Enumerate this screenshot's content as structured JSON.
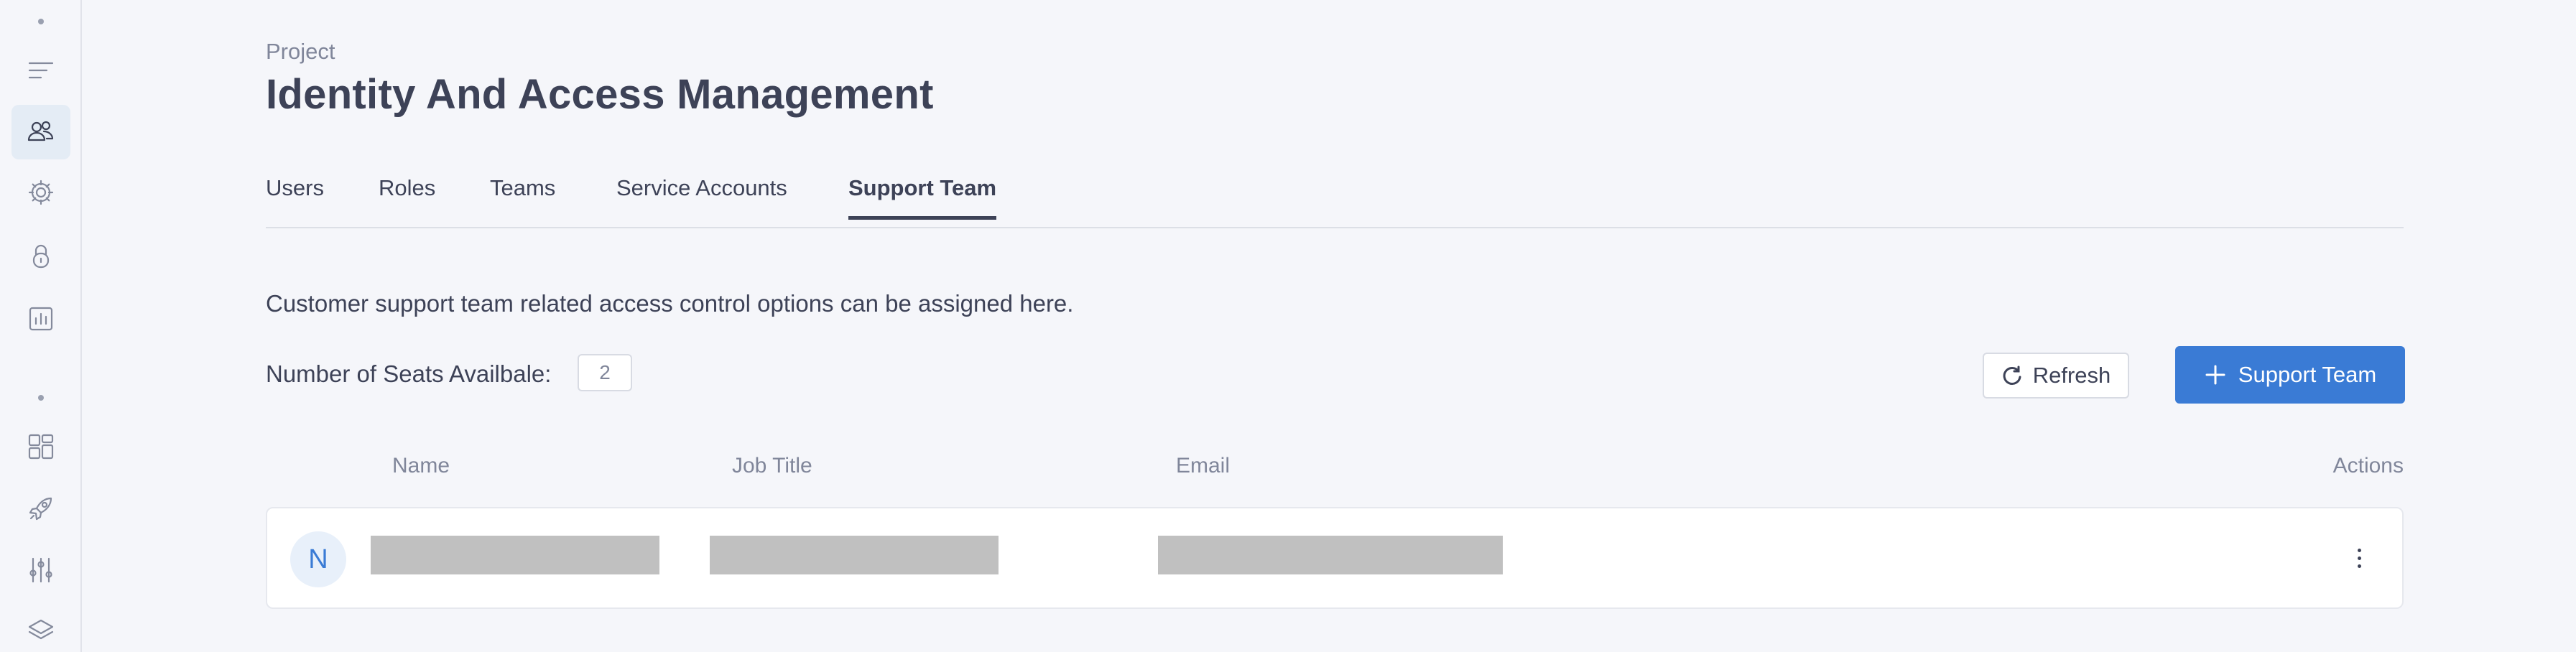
{
  "sidebar": {
    "items": [
      {
        "icon": "menu-lines-icon"
      },
      {
        "icon": "users-icon",
        "active": true
      },
      {
        "icon": "gear-icon"
      },
      {
        "icon": "lock-icon"
      },
      {
        "icon": "bar-chart-icon"
      },
      {
        "icon": "dashboard-grid-icon"
      },
      {
        "icon": "rocket-icon"
      },
      {
        "icon": "sliders-icon"
      },
      {
        "icon": "layers-icon"
      }
    ]
  },
  "header": {
    "eyebrow": "Project",
    "title": "Identity And Access Management"
  },
  "tabs": [
    {
      "label": "Users"
    },
    {
      "label": "Roles"
    },
    {
      "label": "Teams"
    },
    {
      "label": "Service Accounts"
    },
    {
      "label": "Support Team",
      "active": true
    }
  ],
  "content": {
    "description": "Customer support team related access control options can be assigned here.",
    "seats_label": "Number of Seats Availbale:",
    "seats_value": "2",
    "refresh_label": "Refresh",
    "add_label": "Support Team"
  },
  "table": {
    "columns": [
      "Name",
      "Job Title",
      "Email",
      "Actions"
    ],
    "rows": [
      {
        "avatar_initial": "N",
        "name": "",
        "job_title": "",
        "email": ""
      }
    ]
  },
  "colors": {
    "accent": "#3a7bd5",
    "text": "#3d4257",
    "muted": "#80869a",
    "background": "#f5f6fa",
    "redaction": "#c0c0c0"
  }
}
